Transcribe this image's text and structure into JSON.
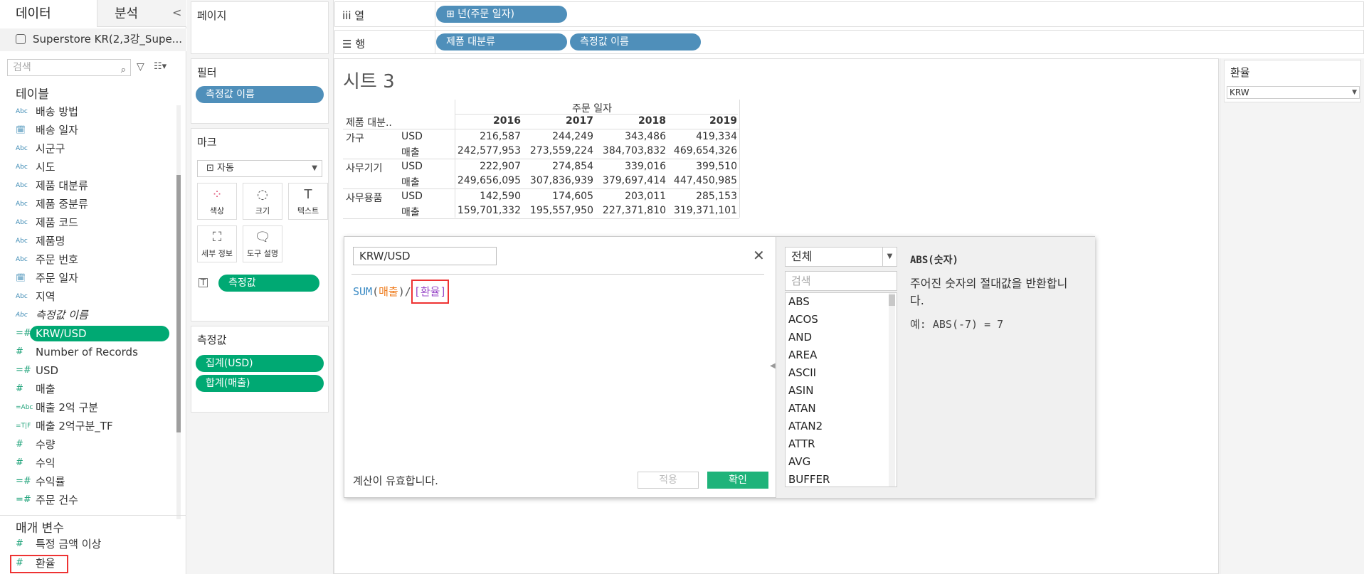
{
  "left": {
    "tabs": {
      "data": "데이터",
      "analysis": "분석"
    },
    "collapse": "<",
    "datasource": "Superstore KR(2,3강_Supe...",
    "search_placeholder": "검색",
    "tables_heading": "테이블",
    "fields": [
      {
        "icon": "Abc",
        "label": "배송 방법"
      },
      {
        "icon": "🗓",
        "label": "배송 일자"
      },
      {
        "icon": "Abc",
        "label": "시군구"
      },
      {
        "icon": "Abc",
        "label": "시도"
      },
      {
        "icon": "Abc",
        "label": "제품 대분류"
      },
      {
        "icon": "Abc",
        "label": "제품 중분류"
      },
      {
        "icon": "Abc",
        "label": "제품 코드"
      },
      {
        "icon": "Abc",
        "label": "제품명"
      },
      {
        "icon": "Abc",
        "label": "주문 번호"
      },
      {
        "icon": "🗓",
        "label": "주문 일자"
      },
      {
        "icon": "Abc",
        "label": "지역"
      },
      {
        "icon": "Abc",
        "label": "측정값 이름"
      },
      {
        "icon": "=#",
        "label": "KRW/USD"
      },
      {
        "icon": "#",
        "label": "Number of Records"
      },
      {
        "icon": "=#",
        "label": "USD"
      },
      {
        "icon": "#",
        "label": "매출"
      },
      {
        "icon": "=Abc",
        "label": "매출 2억 구분"
      },
      {
        "icon": "=T|F",
        "label": "매출 2억구분_TF"
      },
      {
        "icon": "#",
        "label": "수량"
      },
      {
        "icon": "#",
        "label": "수익"
      },
      {
        "icon": "=#",
        "label": "수익률"
      },
      {
        "icon": "=#",
        "label": "주문 건수"
      }
    ],
    "params_heading": "매개 변수",
    "params": [
      {
        "icon": "#",
        "label": "특정 금액 이상"
      },
      {
        "icon": "#",
        "label": "환율"
      }
    ]
  },
  "cards": {
    "pages": "페이지",
    "filters": "필터",
    "filter_pill": "측정값 이름",
    "marks": "마크",
    "marks_type": "자동",
    "marks_buttons": [
      {
        "icon": "⁘",
        "label": "색상"
      },
      {
        "icon": "◌",
        "label": "크기"
      },
      {
        "icon": "T",
        "label": "텍스트"
      },
      {
        "icon": "⛶",
        "label": "세부 정보"
      },
      {
        "icon": "🗨",
        "label": "도구 설명"
      }
    ],
    "marks_pill": "측정값",
    "measures": "측정값",
    "measure_pills": [
      "집계(USD)",
      "합계(매출)"
    ]
  },
  "shelves": {
    "columns_label": "열",
    "columns_pill": "⊞ 년(주문 일자)",
    "rows_label": "행",
    "rows_pills": [
      "제품 대분류",
      "측정값 이름"
    ]
  },
  "sheet": {
    "title": "시트 3",
    "col_header": "주문 일자",
    "row_header": "제품 대분..",
    "years": [
      "2016",
      "2017",
      "2018",
      "2019"
    ],
    "rows": [
      {
        "cat": "가구",
        "measure": "USD",
        "values": [
          "216,587",
          "244,249",
          "343,486",
          "419,334"
        ]
      },
      {
        "cat": "",
        "measure": "매출",
        "values": [
          "242,577,953",
          "273,559,224",
          "384,703,832",
          "469,654,326"
        ]
      },
      {
        "cat": "사무기기",
        "measure": "USD",
        "values": [
          "222,907",
          "274,854",
          "339,016",
          "399,510"
        ]
      },
      {
        "cat": "",
        "measure": "매출",
        "values": [
          "249,656,095",
          "307,836,939",
          "379,697,414",
          "447,450,985"
        ]
      },
      {
        "cat": "사무용품",
        "measure": "USD",
        "values": [
          "142,590",
          "174,605",
          "203,011",
          "285,153"
        ]
      },
      {
        "cat": "",
        "measure": "매출",
        "values": [
          "159,701,332",
          "195,557,950",
          "227,371,810",
          "319,371,101"
        ]
      }
    ]
  },
  "calc": {
    "name": "KRW/USD",
    "close": "✕",
    "formula": {
      "fn": "SUM",
      "open": "(",
      "field": "매출",
      "close": ")",
      "op": "/",
      "param": "[환율]"
    },
    "valid_text": "계산이 유효합니다.",
    "apply": "적용",
    "ok": "확인",
    "category": "전체",
    "fn_search_placeholder": "검색",
    "functions": [
      "ABS",
      "ACOS",
      "AND",
      "AREA",
      "ASCII",
      "ASIN",
      "ATAN",
      "ATAN2",
      "ATTR",
      "AVG",
      "BUFFER"
    ],
    "doc_title": "ABS(숫자)",
    "doc_desc": "주어진 숫자의 절대값을 반환합니다.",
    "doc_example": "예: ABS(-7) = 7"
  },
  "param_card": {
    "title": "환율",
    "value": "KRW"
  }
}
